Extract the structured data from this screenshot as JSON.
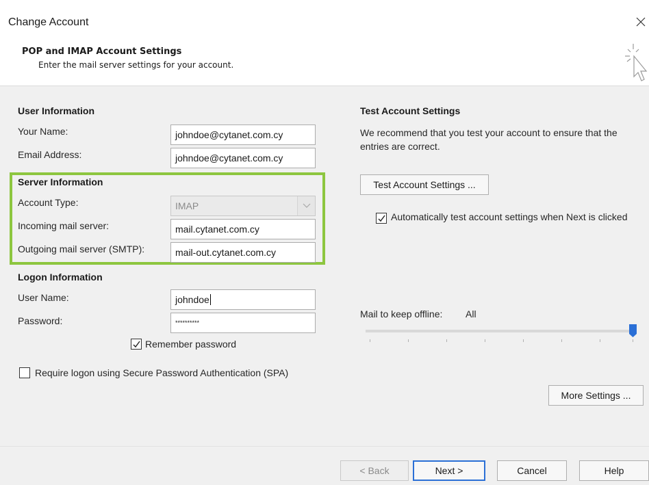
{
  "window": {
    "title": "Change Account",
    "close_icon": "close-icon"
  },
  "header": {
    "title": "POP and IMAP Account Settings",
    "subtitle": "Enter the mail server settings for your account.",
    "icon": "wizard-cursor-icon"
  },
  "user_info": {
    "heading": "User Information",
    "name_label": "Your Name:",
    "name_value": "johndoe@cytanet.com.cy",
    "email_label": "Email Address:",
    "email_value": "johndoe@cytanet.com.cy"
  },
  "server_info": {
    "heading": "Server Information",
    "account_type_label": "Account Type:",
    "account_type_value": "IMAP",
    "incoming_label": "Incoming mail server:",
    "incoming_value": "mail.cytanet.com.cy",
    "outgoing_label": "Outgoing mail server (SMTP):",
    "outgoing_value": "mail-out.cytanet.com.cy"
  },
  "logon_info": {
    "heading": "Logon Information",
    "username_label": "User Name:",
    "username_value": "johndoe",
    "password_label": "Password:",
    "password_value": "**********",
    "remember_label": "Remember password",
    "remember_checked": true,
    "spa_label": "Require logon using Secure Password Authentication (SPA)",
    "spa_checked": false
  },
  "test_settings": {
    "heading": "Test Account Settings",
    "description": "We recommend that you test your account to ensure that the entries are correct.",
    "button_label": "Test Account Settings ...",
    "auto_test_label": "Automatically test account settings when Next is clicked",
    "auto_test_checked": true
  },
  "offline": {
    "label": "Mail to keep offline:",
    "value": "All",
    "slider_fraction": 1.0
  },
  "more_settings_label": "More Settings ...",
  "footer": {
    "back_label": "< Back",
    "next_label": "Next >",
    "cancel_label": "Cancel",
    "help_label": "Help"
  },
  "colors": {
    "highlight": "#8dc63f",
    "primary_border": "#2a6fd6",
    "slider_thumb": "#2a6fd6"
  }
}
